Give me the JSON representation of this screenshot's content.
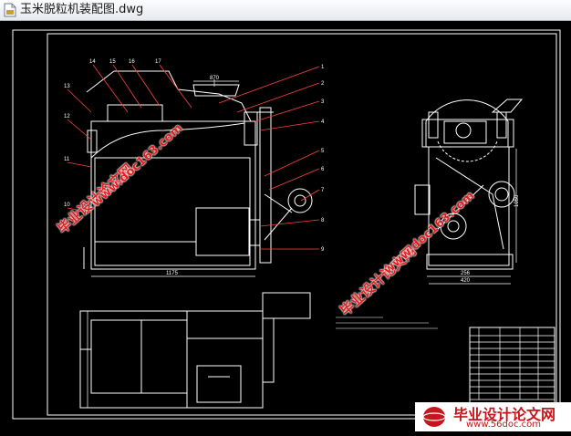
{
  "window": {
    "title": "玉米脱粒机装配图.dwg",
    "file_icon": "dwg-file-icon"
  },
  "drawing": {
    "callouts_top": [
      "14",
      "15",
      "16",
      "17"
    ],
    "callouts_left": [
      "13",
      "12",
      "11",
      "10"
    ],
    "callouts_right": [
      "1",
      "2",
      "3",
      "4",
      "5",
      "6",
      "7",
      "8",
      "9"
    ],
    "dim_top": "870",
    "dim_bottom": "1175",
    "dim_side_width": "256",
    "dim_side_total": "420",
    "dim_side_height": "1050"
  },
  "watermarks": [
    {
      "text": "毕业设计论文网",
      "kind": "cn"
    },
    {
      "text": "www.doc163.com",
      "kind": "url"
    },
    {
      "text": "毕业设计论文网",
      "kind": "cn"
    },
    {
      "text": "www.doc163.com",
      "kind": "url"
    }
  ],
  "footer": {
    "logo_text": "毕业设计论文网",
    "logo_url": "www.56doc.com"
  },
  "colors": {
    "background": "#000000",
    "lines": "#ffffff",
    "watermark": "#e02020",
    "leader": "#ff0000"
  }
}
